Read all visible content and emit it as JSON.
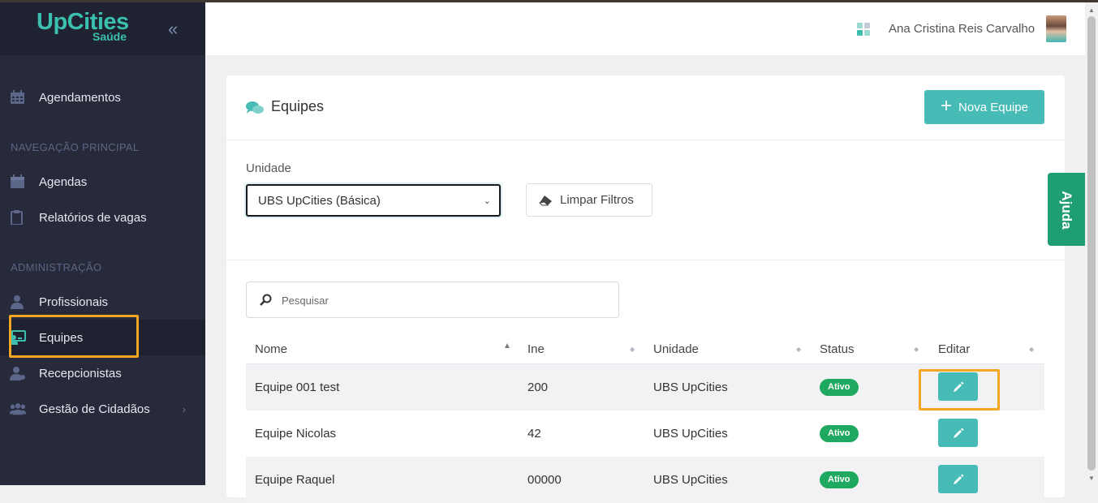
{
  "app": {
    "logo_main": "UpCities",
    "logo_sub": "Saúde"
  },
  "sidebar": {
    "items": [
      {
        "label": "Agendamentos",
        "icon": "calendar-icon"
      },
      {
        "label": "Agendas",
        "icon": "calendar-icon"
      },
      {
        "label": "Relatórios de vagas",
        "icon": "clipboard-icon"
      },
      {
        "label": "Profissionais",
        "icon": "user-md-icon"
      },
      {
        "label": "Equipes",
        "icon": "teacher-board-icon"
      },
      {
        "label": "Recepcionistas",
        "icon": "user-gear-icon"
      },
      {
        "label": "Gestão de Cidadãos",
        "icon": "users-icon"
      }
    ],
    "sections": {
      "principal": "NAVEGAÇÃO PRINCIPAL",
      "admin": "ADMINISTRAÇÃO"
    }
  },
  "header": {
    "user_name": "Ana Cristina Reis Carvalho"
  },
  "page": {
    "title": "Equipes",
    "new_button": "Nova Equipe",
    "filter_label": "Unidade",
    "unit_selected": "UBS UpCities (Básica)",
    "clear_filters": "Limpar Filtros",
    "search_placeholder": "Pesquisar"
  },
  "table": {
    "headers": [
      "Nome",
      "Ine",
      "Unidade",
      "Status",
      "Editar"
    ],
    "rows": [
      {
        "nome": "Equipe 001 test",
        "ine": "200",
        "unidade": "UBS UpCities",
        "status": "Ativo"
      },
      {
        "nome": "Equipe Nicolas",
        "ine": "42",
        "unidade": "UBS UpCities",
        "status": "Ativo"
      },
      {
        "nome": "Equipe Raquel",
        "ine": "00000",
        "unidade": "UBS UpCities",
        "status": "Ativo"
      }
    ]
  },
  "help": {
    "label": "Ajuda"
  },
  "colors": {
    "accent": "#47bcb6",
    "sidebar": "#272a3a",
    "highlight": "#f5a623",
    "status_active": "#1fa85f"
  }
}
